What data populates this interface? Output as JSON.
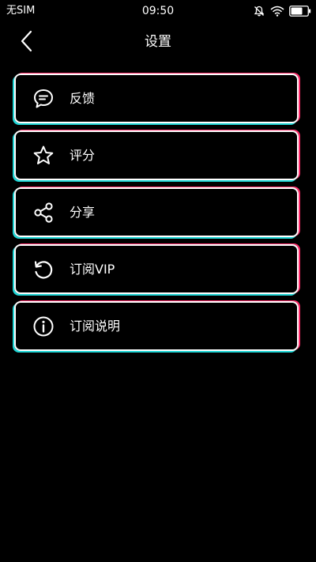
{
  "status_bar": {
    "carrier": "无SIM",
    "time": "09:50"
  },
  "header": {
    "title": "设置",
    "back_icon": "chevron-left-icon"
  },
  "menu": {
    "items": [
      {
        "label": "反馈",
        "icon": "chat-bubble-icon"
      },
      {
        "label": "评分",
        "icon": "star-icon"
      },
      {
        "label": "分享",
        "icon": "share-icon"
      },
      {
        "label": "订阅VIP",
        "icon": "restore-icon"
      },
      {
        "label": "订阅说明",
        "icon": "info-icon"
      }
    ]
  },
  "colors": {
    "background": "#000000",
    "foreground": "#ffffff",
    "glitch_cyan": "#1fd6d6",
    "glitch_pink": "#ff2a6a"
  }
}
